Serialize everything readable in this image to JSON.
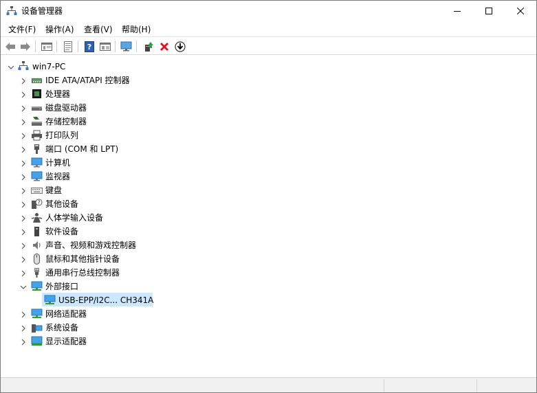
{
  "window": {
    "title": "设备管理器",
    "icon": "device-manager-icon"
  },
  "menu": {
    "items": [
      "文件(F)",
      "操作(A)",
      "查看(V)",
      "帮助(H)"
    ]
  },
  "toolbar": {
    "buttons": [
      "back-arrow-icon",
      "forward-arrow-icon",
      "properties-pane-icon",
      "document-icon",
      "help-icon",
      "view-icon",
      "monitor-scan-icon",
      "update-driver-icon",
      "uninstall-x-icon",
      "download-icon"
    ]
  },
  "tree": {
    "root": "win7-PC",
    "categories": [
      {
        "label": "IDE ATA/ATAPI 控制器",
        "icon": "ide-controller-icon"
      },
      {
        "label": "处理器",
        "icon": "processor-icon"
      },
      {
        "label": "磁盘驱动器",
        "icon": "disk-drive-icon"
      },
      {
        "label": "存储控制器",
        "icon": "storage-controller-icon"
      },
      {
        "label": "打印队列",
        "icon": "printer-icon"
      },
      {
        "label": "端口 (COM 和 LPT)",
        "icon": "port-icon"
      },
      {
        "label": "计算机",
        "icon": "computer-icon"
      },
      {
        "label": "监视器",
        "icon": "monitor-icon"
      },
      {
        "label": "键盘",
        "icon": "keyboard-icon"
      },
      {
        "label": "其他设备",
        "icon": "unknown-device-icon"
      },
      {
        "label": "人体学输入设备",
        "icon": "hid-icon"
      },
      {
        "label": "软件设备",
        "icon": "software-device-icon"
      },
      {
        "label": "声音、视频和游戏控制器",
        "icon": "speaker-icon"
      },
      {
        "label": "鼠标和其他指针设备",
        "icon": "mouse-icon"
      },
      {
        "label": "通用串行总线控制器",
        "icon": "usb-icon"
      },
      {
        "label": "外部接口",
        "icon": "network-adapter-icon"
      },
      {
        "label": "网络适配器",
        "icon": "network-adapter-icon"
      },
      {
        "label": "系统设备",
        "icon": "system-device-icon"
      },
      {
        "label": "显示适配器",
        "icon": "display-adapter-icon"
      }
    ],
    "expanded_child": "USB-EPP/I2C... CH341A"
  },
  "colors": {
    "selection": "#cce8ff",
    "delete_red": "#e81123"
  }
}
